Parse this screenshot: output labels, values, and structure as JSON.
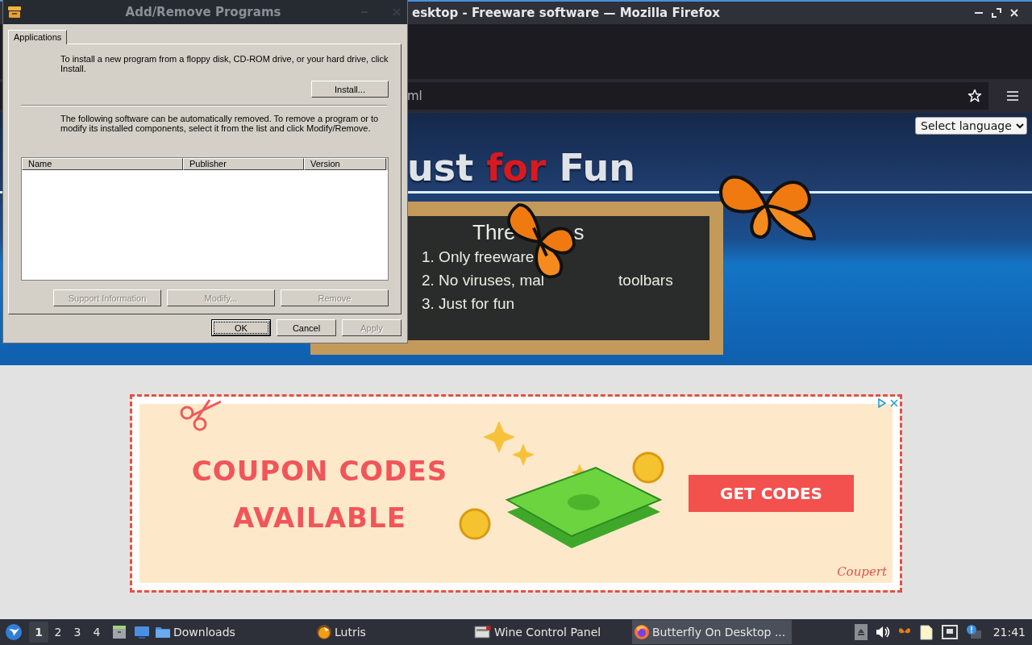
{
  "dialog": {
    "title": "Add/Remove Programs",
    "tabs": [
      {
        "label": "Applications",
        "selected": true
      }
    ],
    "install_text": "To install a new program from a floppy disk, CD-ROM drive, or your hard drive, click Install.",
    "install_button": "Install...",
    "remove_text": "The following software can be automatically removed. To remove a program or to modify its installed components, select it from the list and click Modify/Remove.",
    "columns": [
      "Name",
      "Publisher",
      "Version"
    ],
    "list_buttons": [
      {
        "label": "Support Information",
        "disabled": true
      },
      {
        "label": "Modify...",
        "disabled": true
      },
      {
        "label": "Remove",
        "disabled": true
      }
    ],
    "footer_buttons": [
      {
        "label": "OK",
        "disabled": false,
        "focused": true
      },
      {
        "label": "Cancel",
        "disabled": false,
        "focused": false
      },
      {
        "label": "Apply",
        "disabled": true,
        "focused": false
      }
    ]
  },
  "browser": {
    "title": "esktop - Freeware software — Mozilla Firefox",
    "url": "ml",
    "language_select": "Select language",
    "headline": [
      {
        "text": "ust",
        "kind": "plain"
      },
      {
        "text": "for",
        "kind": "accent"
      },
      {
        "text": "Fun",
        "kind": "plain"
      }
    ],
    "board": {
      "title": [
        "Thre",
        "s"
      ],
      "lines": [
        [
          "1. Only freeware"
        ],
        [
          "2. No viruses, mal",
          "toolbars"
        ],
        [
          "3. Just for fun"
        ]
      ]
    },
    "ad": {
      "headline": [
        "COUPON CODES",
        "AVAILABLE"
      ],
      "button": "GET CODES",
      "logo": "Coupert"
    }
  },
  "taskbar": {
    "workspaces": [
      {
        "label": "1",
        "selected": true
      },
      {
        "label": "2",
        "selected": false
      },
      {
        "label": "3",
        "selected": false
      },
      {
        "label": "4",
        "selected": false
      }
    ],
    "tasks": [
      {
        "label": "Downloads",
        "kind": "folder",
        "selected": false
      },
      {
        "label": "Lutris",
        "kind": "lutris",
        "selected": false
      },
      {
        "label": "Wine Control Panel",
        "kind": "wine",
        "selected": false
      },
      {
        "label": "Butterfly On Desktop ...",
        "kind": "firefox",
        "selected": true
      }
    ],
    "clock": "21:41"
  }
}
